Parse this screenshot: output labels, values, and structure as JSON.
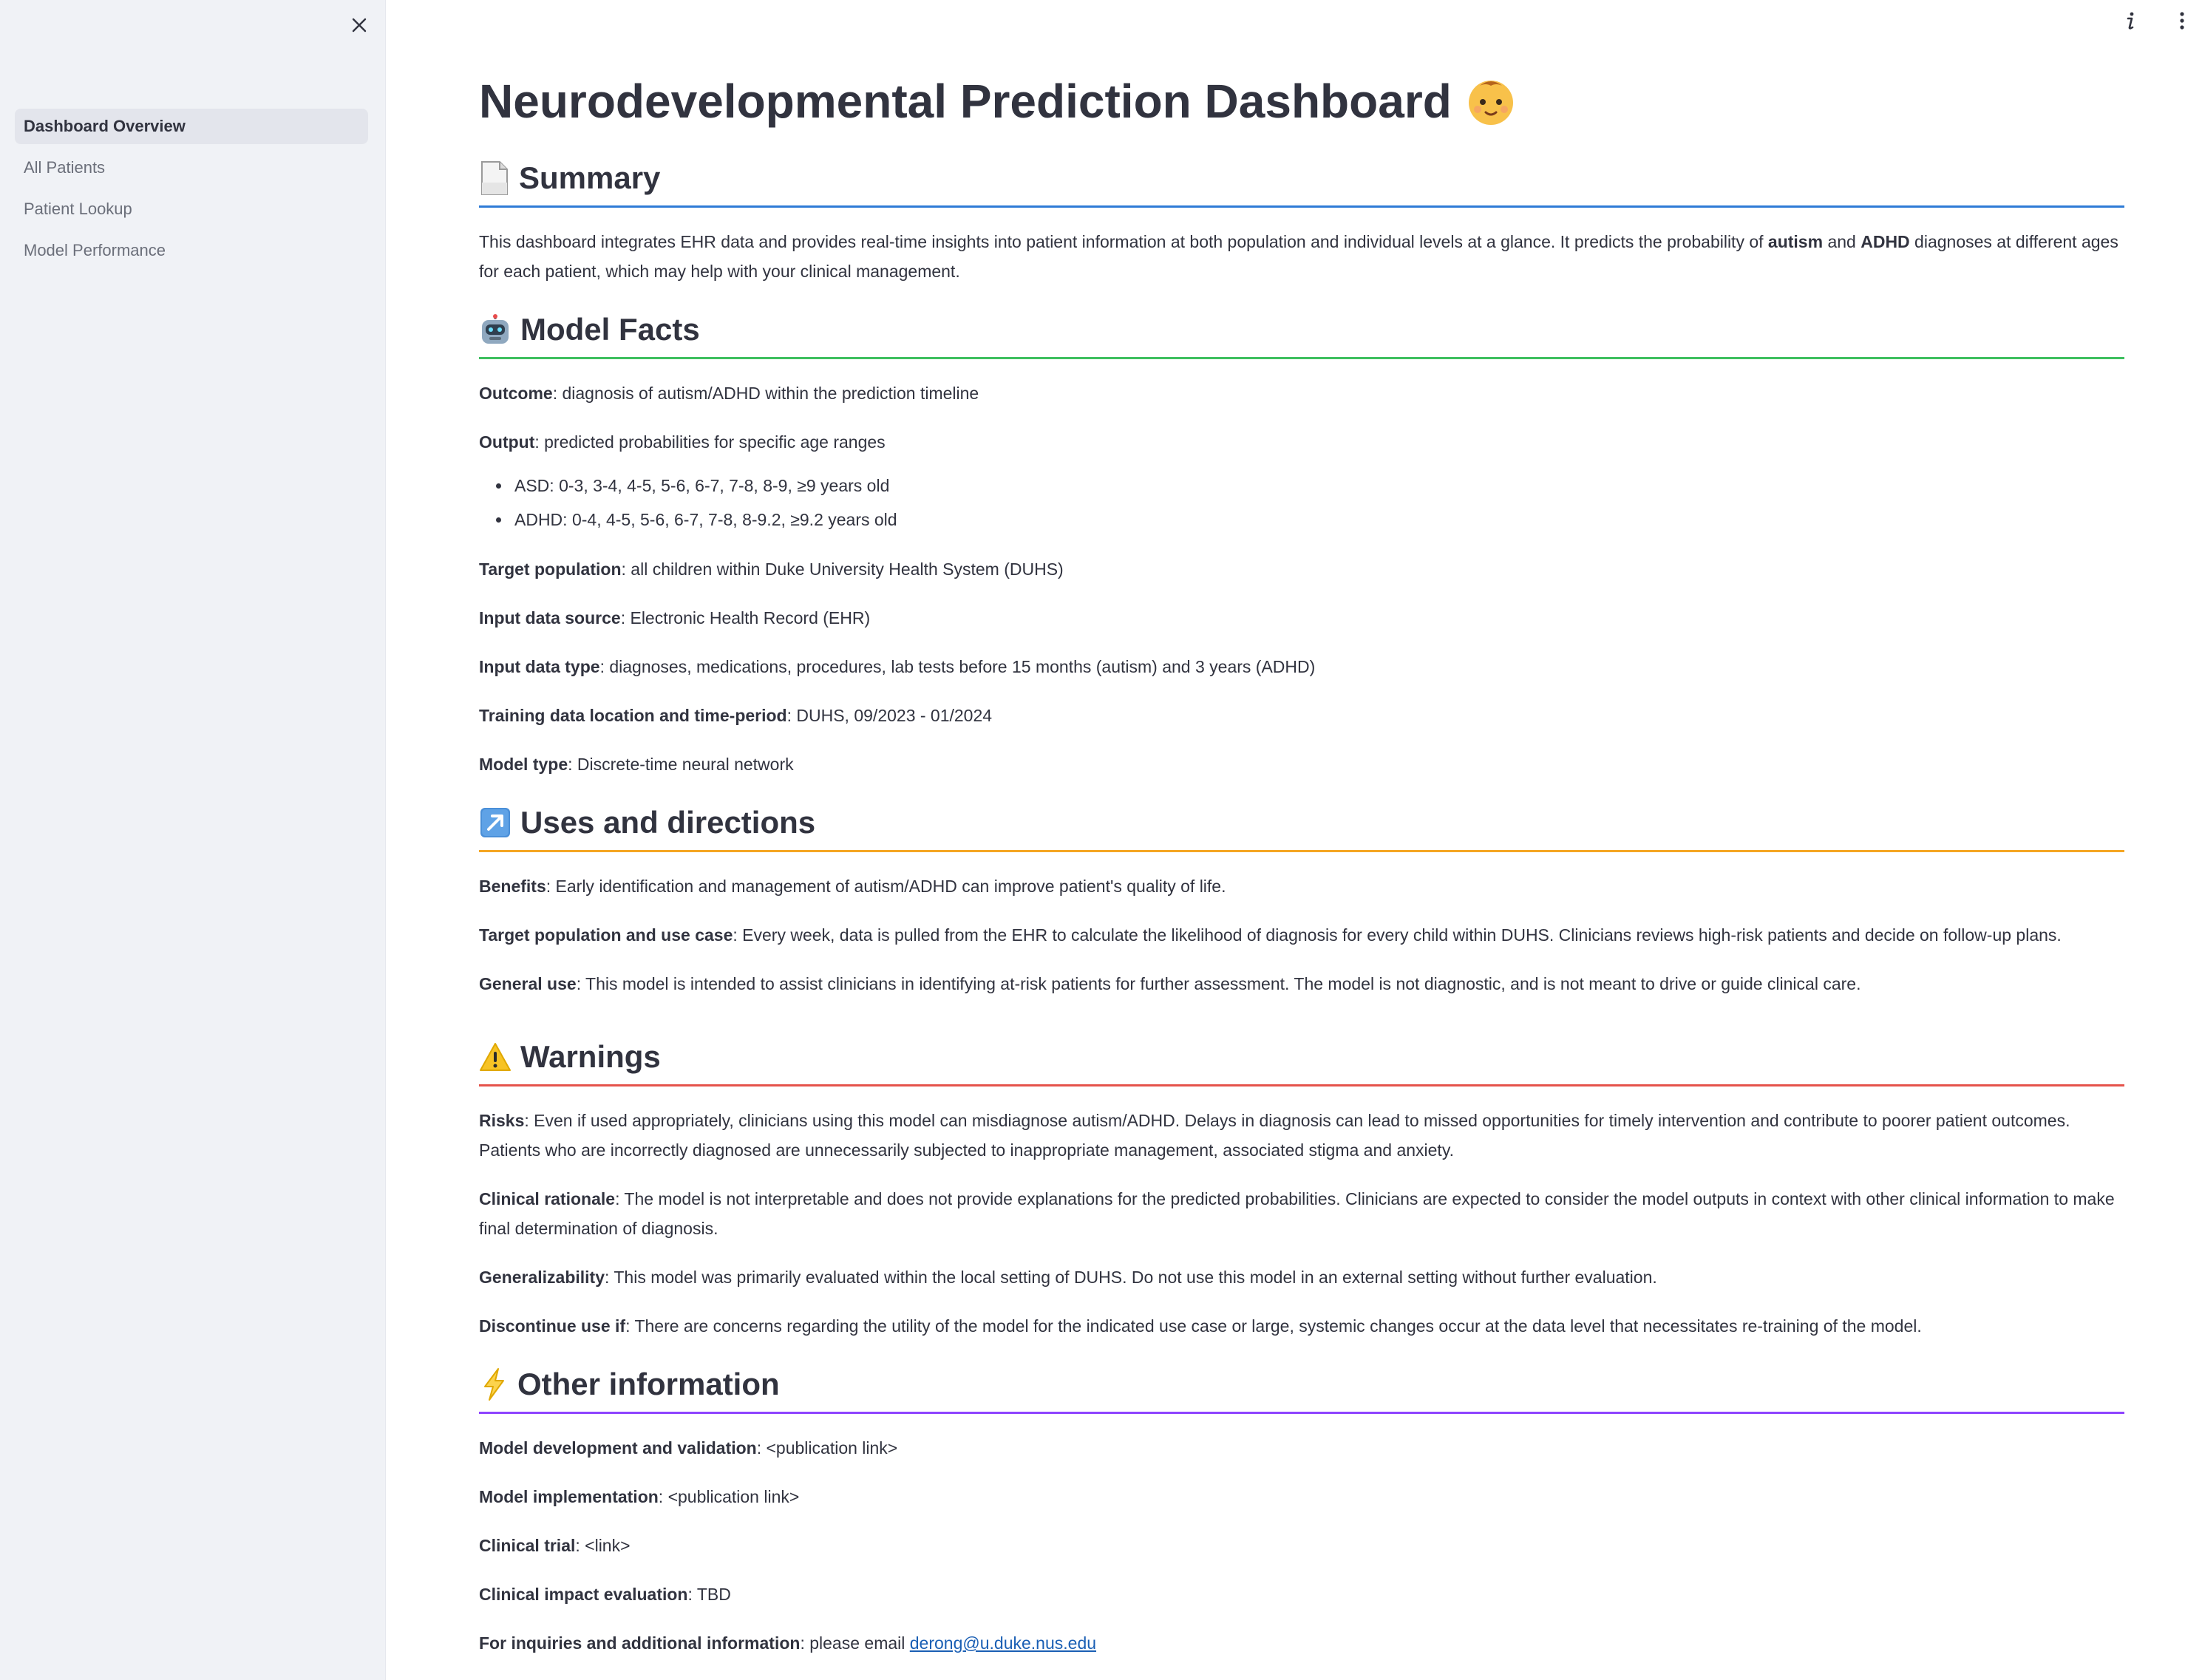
{
  "sidebar": {
    "nav": [
      {
        "label": "Dashboard Overview",
        "active": true
      },
      {
        "label": "All Patients",
        "active": false
      },
      {
        "label": "Patient Lookup",
        "active": false
      },
      {
        "label": "Model Performance",
        "active": false
      }
    ]
  },
  "icons": {
    "close": "close-icon",
    "info": "info-icon",
    "menu": "more-vertical-icon",
    "title": "baby-face-icon",
    "summary": "document-icon",
    "model_facts": "robot-icon",
    "uses": "arrow-up-right-icon",
    "warnings": "warning-icon",
    "other": "lightning-icon"
  },
  "colors": {
    "summary": "#2e7bd6",
    "model_facts": "#3ebf5f",
    "uses": "#f5a623",
    "warnings": "#e5534b",
    "other": "#8e44ff"
  },
  "title": "Neurodevelopmental Prediction Dashboard",
  "summary": {
    "heading": "Summary",
    "text_1": "This dashboard integrates EHR data and provides real-time insights into patient information at both population and individual levels at a glance. It predicts the probability of ",
    "bold_1": "autism",
    "text_2": " and ",
    "bold_2": "ADHD",
    "text_3": " diagnoses at different ages for each patient, which may help with your clinical management."
  },
  "model_facts": {
    "heading": "Model Facts",
    "outcome_label": "Outcome",
    "outcome_value": ": diagnosis of autism/ADHD within the prediction timeline",
    "output_label": "Output",
    "output_value": ": predicted probabilities for specific age ranges",
    "bullets": [
      "ASD: 0-3, 3-4, 4-5, 5-6, 6-7, 7-8, 8-9, ≥9 years old",
      "ADHD: 0-4, 4-5, 5-6, 6-7, 7-8, 8-9.2, ≥9.2 years old"
    ],
    "target_label": "Target population",
    "target_value": ": all children within Duke University Health System (DUHS)",
    "source_label": "Input data source",
    "source_value": ": Electronic Health Record (EHR)",
    "type_label": "Input data type",
    "type_value": ": diagnoses, medications, procedures, lab tests before 15 months (autism) and 3 years (ADHD)",
    "training_label": "Training data location and time-period",
    "training_value": ": DUHS, 09/2023 - 01/2024",
    "model_label": "Model type",
    "model_value": ": Discrete-time neural network"
  },
  "uses": {
    "heading": "Uses and directions",
    "benefits_label": "Benefits",
    "benefits_value": ": Early identification and management of autism/ADHD can improve patient's quality of life.",
    "target_label": "Target population and use case",
    "target_value": ": Every week, data is pulled from the EHR to calculate the likelihood of diagnosis for every child within DUHS. Clinicians reviews high-risk patients and decide on follow-up plans.",
    "general_label": "General use",
    "general_value": ": This model is intended to assist clinicians in identifying at-risk patients for further assessment. The model is not diagnostic, and is not meant to drive or guide clinical care."
  },
  "warnings": {
    "heading": "Warnings",
    "risks_label": "Risks",
    "risks_value": ": Even if used appropriately, clinicians using this model can misdiagnose autism/ADHD. Delays in diagnosis can lead to missed opportunities for timely intervention and contribute to poorer patient outcomes. Patients who are incorrectly diagnosed are unnecessarily subjected to inappropriate management, associated stigma and anxiety.",
    "rationale_label": "Clinical rationale",
    "rationale_value": ": The model is not interpretable and does not provide explanations for the predicted probabilities. Clinicians are expected to consider the model outputs in context with other clinical information to make final determination of diagnosis.",
    "general_label": "Generalizability",
    "general_value": ": This model was primarily evaluated within the local setting of DUHS. Do not use this model in an external setting without further evaluation.",
    "discontinue_label": "Discontinue use if",
    "discontinue_value": ": There are concerns regarding the utility of the model for the indicated use case or large, systemic changes occur at the data level that necessitates re-training of the model."
  },
  "other": {
    "heading": "Other information",
    "dev_label": "Model development and validation",
    "dev_value": ": <publication link>",
    "impl_label": "Model implementation",
    "impl_value": ": <publication link>",
    "trial_label": "Clinical trial",
    "trial_value": ": <link>",
    "impact_label": "Clinical impact evaluation",
    "impact_value": ": TBD",
    "inquiry_label": "For inquiries and additional information",
    "inquiry_value": ": please email ",
    "email": "derong@u.duke.nus.edu"
  }
}
